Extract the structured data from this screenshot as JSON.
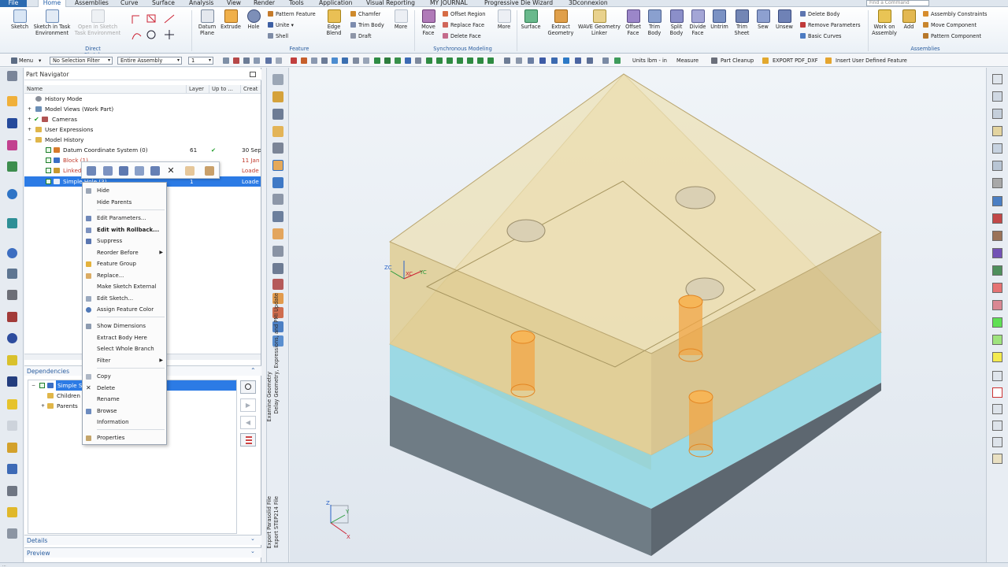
{
  "menu_tabs": [
    "File",
    "Home",
    "Assemblies",
    "Curve",
    "Surface",
    "Analysis",
    "View",
    "Render",
    "Tools",
    "Application",
    "Visual Reporting",
    "MY JOURNAL",
    "Progressive Die Wizard",
    "3Dconnexion"
  ],
  "search": {
    "placeholder": "Find a Command"
  },
  "ribbon": {
    "direct_sketch": {
      "sketch": "Sketch",
      "task_env": "Sketch in Task Environment",
      "open_task": "Open in Sketch Task Environment",
      "group": "Direct Sketch"
    },
    "feature": {
      "datum_plane": "Datum Plane",
      "extrude": "Extrude",
      "hole": "Hole",
      "pattern_feature": "Pattern Feature",
      "unite": "Unite",
      "shell": "Shell",
      "edge_blend": "Edge Blend",
      "chamfer": "Chamfer",
      "trim_body": "Trim Body",
      "draft": "Draft",
      "more": "More",
      "group": "Feature"
    },
    "sync": {
      "move_face": "Move Face",
      "offset_region": "Offset Region",
      "replace_face": "Replace Face",
      "delete_face": "Delete Face",
      "more": "More",
      "group": "Synchronous Modeling"
    },
    "surface": {
      "surface": "Surface",
      "extract_geometry": "Extract Geometry",
      "wave": "WAVE Geometry Linker",
      "offset_face": "Offset Face",
      "trim_body": "Trim Body",
      "split_body": "Split Body",
      "divide_face": "Divide Face",
      "untrim": "Untrim",
      "trim_sheet": "Trim Sheet",
      "sew": "Sew",
      "unsew": "Unsew",
      "delete_body": "Delete Body",
      "remove_params": "Remove Parameters",
      "basic_curves": "Basic Curves"
    },
    "assemblies": {
      "work_on_assembly": "Work on Assembly",
      "add": "Add",
      "constraints": "Assembly Constraints",
      "move_component": "Move Component",
      "pattern_component": "Pattern Component",
      "group": "Assemblies"
    }
  },
  "command_bar": {
    "menu": "Menu",
    "selection_filter": "No Selection Filter",
    "scope": "Entire Assembly",
    "layer": "1",
    "units": "Units lbm - in",
    "measure": "Measure",
    "part_cleanup": "Part Cleanup",
    "export_pdf": "EXPORT PDF_DXF",
    "insert_udf": "Insert User Defined Feature"
  },
  "navigator": {
    "title": "Part Navigator",
    "columns": [
      "Name",
      "Layer",
      "Up to ...",
      "Creat"
    ],
    "rows": [
      {
        "name": "History Mode",
        "layer": "",
        "up": "",
        "created": ""
      },
      {
        "name": "Model Views (Work Part)",
        "layer": "",
        "up": "",
        "created": ""
      },
      {
        "name": "Cameras",
        "layer": "",
        "up": "",
        "created": ""
      },
      {
        "name": "User Expressions",
        "layer": "",
        "up": "",
        "created": ""
      },
      {
        "name": "Model History",
        "layer": "",
        "up": "",
        "created": ""
      },
      {
        "name": "Datum Coordinate System (0)",
        "layer": "61",
        "up": "✔",
        "created": "30 Sep"
      },
      {
        "name": "Block (1)",
        "layer": "",
        "up": "",
        "created": "11 Jan"
      },
      {
        "name": "Linked",
        "layer": "",
        "up": "",
        "created": "Loade"
      },
      {
        "name": "Simple Hole (3)",
        "layer": "1",
        "up": "",
        "created": "Loade"
      }
    ]
  },
  "dependencies": {
    "title": "Dependencies",
    "items": [
      "Simple S",
      "Children",
      "Parents"
    ]
  },
  "details": {
    "title": "Details"
  },
  "preview": {
    "title": "Preview"
  },
  "context_menu": [
    "Hide",
    "Hide Parents",
    "Edit Parameters...",
    "Edit with Rollback...",
    "Suppress",
    "Reorder Before",
    "Feature Group",
    "Replace...",
    "Make Sketch External",
    "Edit Sketch...",
    "Assign Feature Color",
    "Show Dimensions",
    "Extract Body Here",
    "Select Whole Branch",
    "Filter",
    "Copy",
    "Delete",
    "Rename",
    "Browse",
    "Information",
    "Properties"
  ],
  "vertical_labels": [
    "Delay Geometry, Expressions, and PMI Update",
    "Examine Geometry",
    "Export STEP214 File",
    "Export Parasolid File"
  ],
  "triad": {
    "zc": "ZC",
    "xc": "XC",
    "yc": "YC",
    "z": "Z",
    "x": "X",
    "y": "Y"
  },
  "colors": {
    "accent": "#2b6ab0",
    "selection": "#2c7be5",
    "block_top": "#ead9a2",
    "block_lower": "#8fd6e2",
    "hole": "#f19a2c"
  },
  "status_text": "..."
}
